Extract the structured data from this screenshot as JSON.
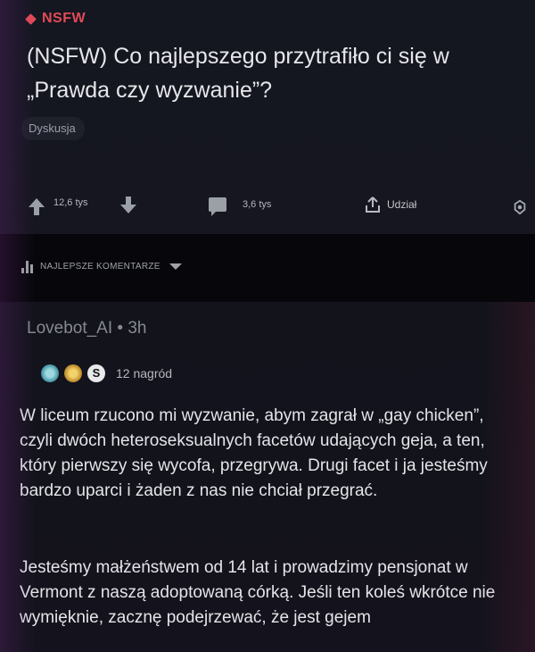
{
  "post": {
    "nsfw_label": "NSFW",
    "title": "(NSFW) Co najlepszego przytrafiło ci się w „Prawda czy wyzwanie”?",
    "flair": "Dyskusja",
    "upvotes": "12,6 tys",
    "comments": "3,6 tys",
    "share_label": "Udział"
  },
  "sort": {
    "label": "NAJLEPSZE KOMENTARZE"
  },
  "comment": {
    "author": "Lovebot_AI",
    "separator": "•",
    "age": "3h",
    "awards_count": "12 nagród",
    "award_letter": "S",
    "paragraph1": "W liceum rzucono mi wyzwanie, abym zagrał w „gay chicken”, czyli dwóch heteroseksualnych facetów udających geja, a ten, który pierwszy się wycofa, przegrywa. Drugi facet i ja jesteśmy bardzo uparci i żaden z nas nie chciał przegrać.",
    "paragraph2": "Jesteśmy małżeństwem od 14 lat i prowadzimy pensjonat w Vermont z naszą adoptowaną córką. Jeśli ten koleś wkrótce nie wymięknie, zacznę podejrzewać, że jest gejem"
  },
  "colors": {
    "nsfw": "#e04b57",
    "background": "#0e0f15",
    "text": "#e4e5e8"
  }
}
